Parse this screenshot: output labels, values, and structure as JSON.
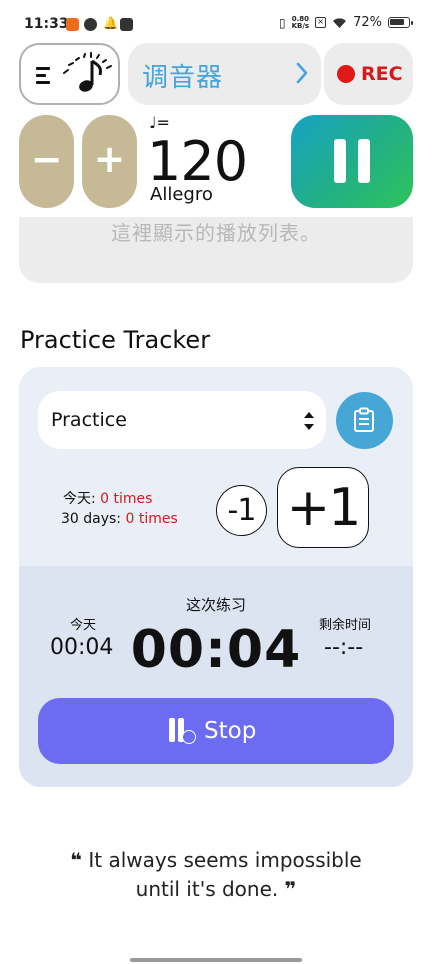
{
  "status_bar": {
    "time": "11:33",
    "net_speed_value": "0.80",
    "net_speed_unit": "KB/s",
    "battery": "72%"
  },
  "header": {
    "tuner_label": "调音器",
    "rec_label": "REC"
  },
  "metronome": {
    "minus_label": "−",
    "plus_label": "+",
    "note_equals": "♩=",
    "tempo": "120",
    "tempo_name": "Allegro"
  },
  "playlist": {
    "hint": "這裡顯示的播放列表。"
  },
  "practice": {
    "title": "Practice Tracker",
    "selected_item": "Practice",
    "today_label": "今天:",
    "today_count": "0 times",
    "days30_label": "30 days:",
    "days30_count": "0 times",
    "minus_one": "-1",
    "plus_one": "+1",
    "today_time_label": "今天",
    "today_time": "00:04",
    "session_label": "这次练习",
    "session_time": "00:04",
    "remaining_label": "剩余时间",
    "remaining_time": "--:--",
    "stop_label": "Stop"
  },
  "quote": {
    "line1": "It always seems impossible",
    "line2": "until it's done.",
    "open_mark": "❝",
    "close_mark": "❞"
  },
  "colors": {
    "accent_blue": "#45a4dc",
    "rec_red": "#e01818",
    "bpm_buttons": "#c6ba96",
    "stop_button": "#6c6cf2",
    "count_red": "#d41a1a"
  }
}
